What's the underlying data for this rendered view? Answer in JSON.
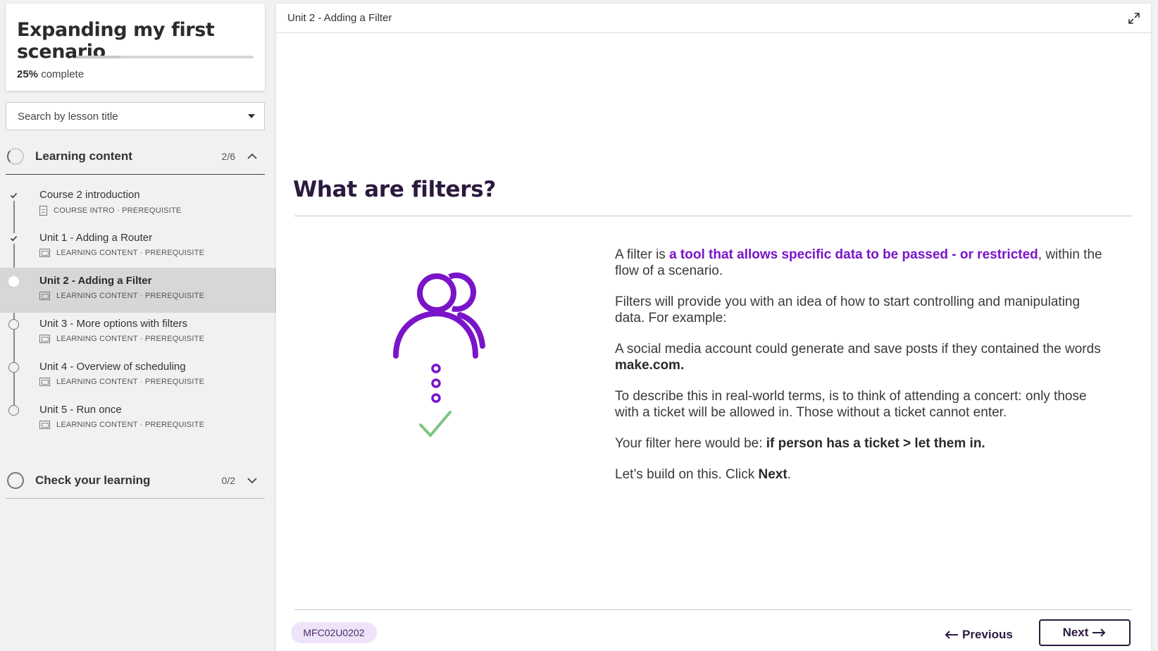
{
  "course": {
    "title": "Expanding my first scenario",
    "progress_percent": "25%",
    "progress_fraction": 0.25,
    "progress_suffix": " complete"
  },
  "search": {
    "placeholder": "Search by lesson title"
  },
  "sections": [
    {
      "title": "Learning content",
      "count": "2/6",
      "lessons": [
        {
          "title": "Course 2 introduction",
          "meta": "COURSE INTRO · PREREQUISITE",
          "status": "complete",
          "icon": "document-icon"
        },
        {
          "title": "Unit 1 - Adding a Router",
          "meta": "LEARNING CONTENT · PREREQUISITE",
          "status": "complete",
          "icon": "slides-icon"
        },
        {
          "title": "Unit 2 - Adding a Filter",
          "meta": "LEARNING CONTENT · PREREQUISITE",
          "status": "current",
          "icon": "slides-icon"
        },
        {
          "title": "Unit 3 - More options with filters",
          "meta": "LEARNING CONTENT · PREREQUISITE",
          "status": "incomplete",
          "icon": "slides-icon"
        },
        {
          "title": "Unit 4 - Overview of scheduling",
          "meta": "LEARNING CONTENT · PREREQUISITE",
          "status": "incomplete",
          "icon": "slides-icon"
        },
        {
          "title": "Unit 5 - Run once",
          "meta": "LEARNING CONTENT · PREREQUISITE",
          "status": "incomplete",
          "icon": "slides-icon"
        }
      ]
    },
    {
      "title": "Check your learning",
      "count": "0/2"
    }
  ],
  "topbar": {
    "title": "Unit 2 - Adding a Filter"
  },
  "content": {
    "heading": "What are filters?",
    "p1_a": "A filter is ",
    "p1_hl": "a tool that allows specific data to be passed - or restricted",
    "p1_b": ", within the flow of a scenario.",
    "p2": "Filters will provide you with an idea of how to start controlling and manipulating data. For example:",
    "p3_a": "A social media account could generate and save posts if they contained the words ",
    "p3_b": "make.com.",
    "p4": "To describe this in real-world terms, is to think of attending a concert: only those with a ticket will be allowed in. Those without a ticket cannot enter.",
    "p5_a": "Your filter here would be: ",
    "p5_b": "if person has a ticket > let them in.",
    "p6_a": "Let’s build on this. Click ",
    "p6_b": "Next",
    "p6_c": "."
  },
  "footer": {
    "code": "MFC02U0202",
    "previous_label": "Previous",
    "next_label": "Next"
  },
  "colors": {
    "accent_purple": "#7a14c9",
    "dark_purple": "#2b1a3e",
    "check_green": "#7cc47f"
  }
}
